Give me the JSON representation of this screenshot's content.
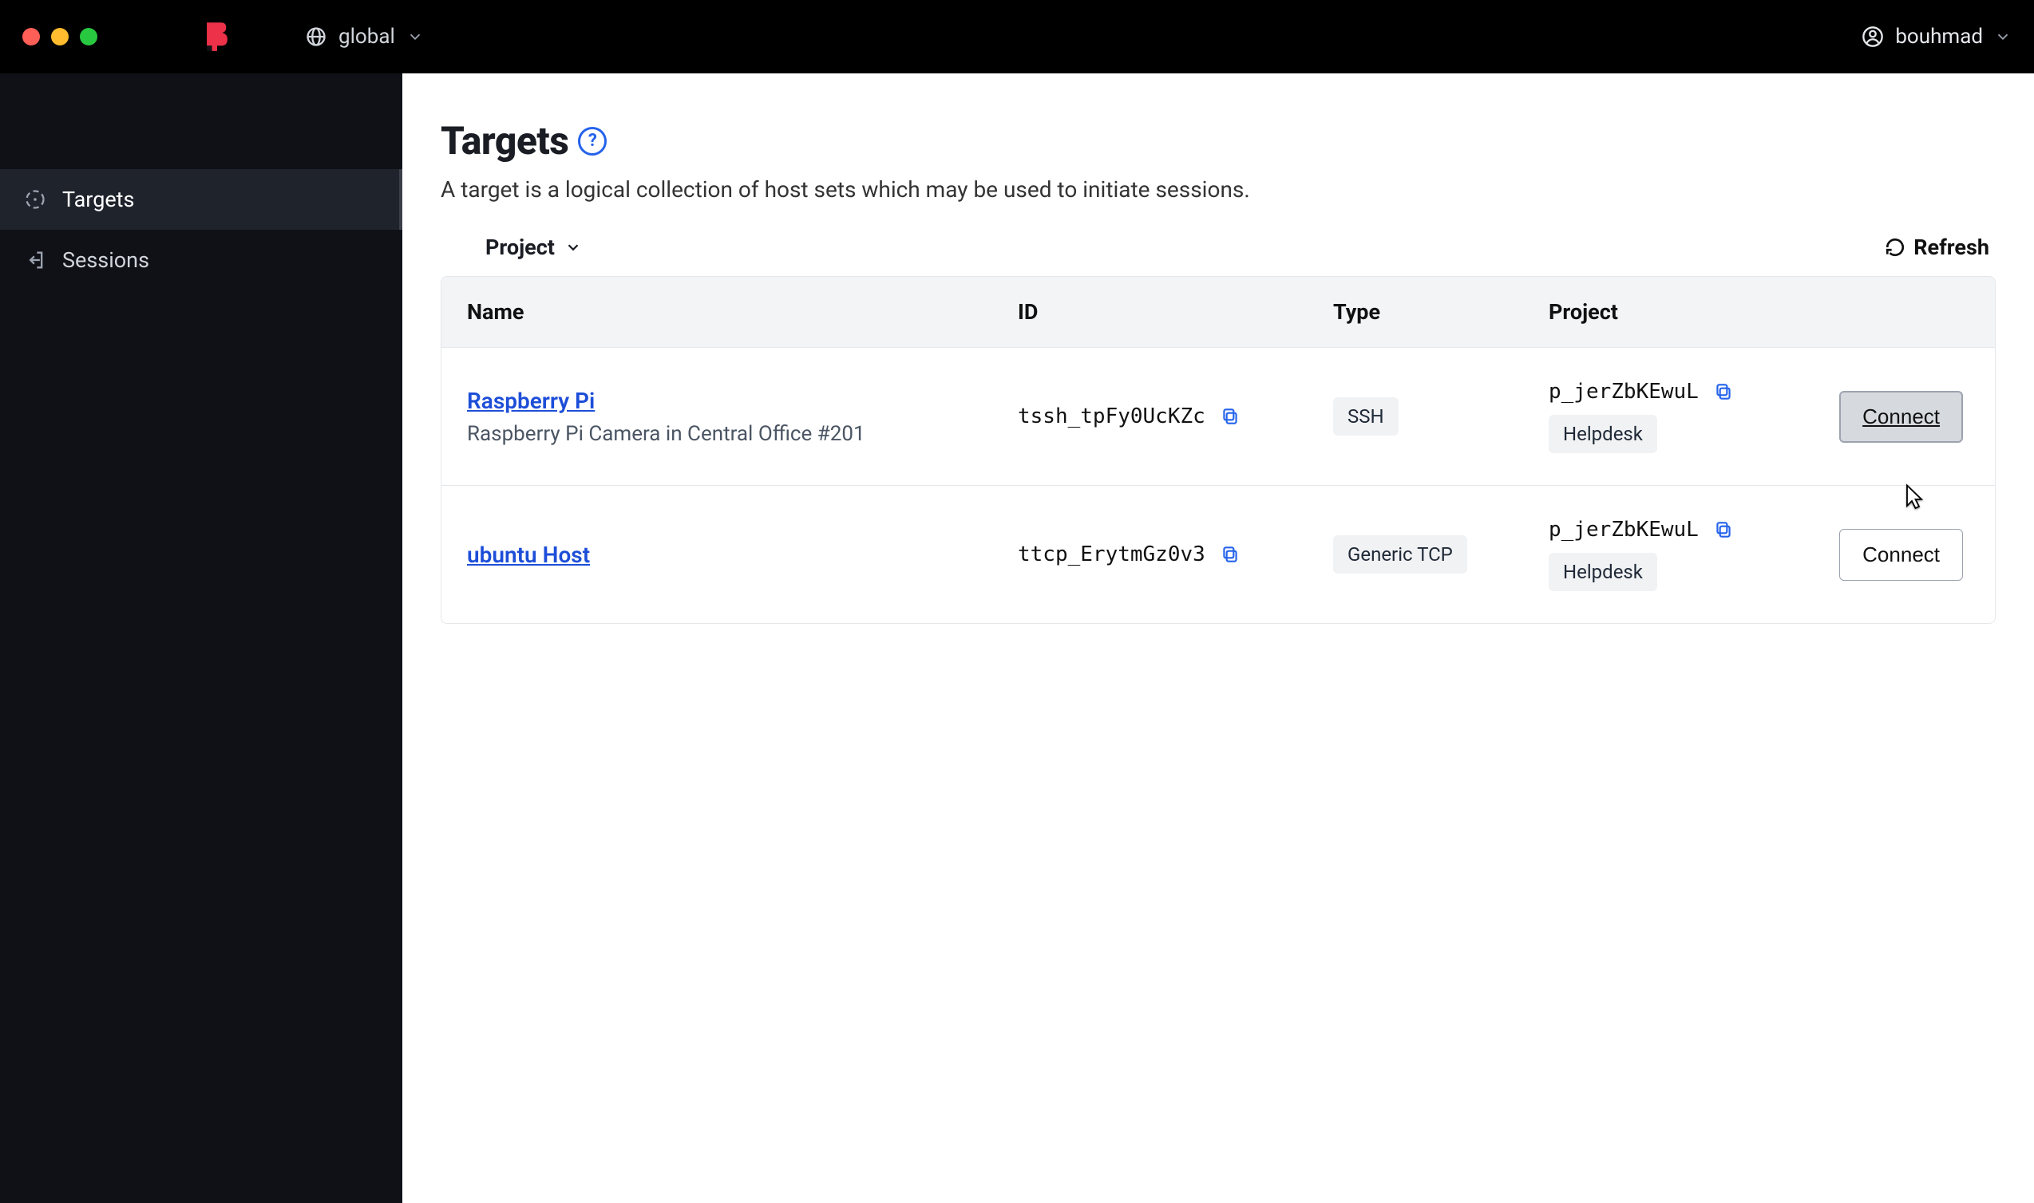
{
  "header": {
    "scope_label": "global",
    "username": "bouhmad"
  },
  "sidebar": {
    "items": [
      {
        "label": "Targets",
        "icon": "target-icon",
        "active": true
      },
      {
        "label": "Sessions",
        "icon": "exit-icon",
        "active": false
      }
    ]
  },
  "main": {
    "title": "Targets",
    "description": "A target is a logical collection of host sets which may be used to initiate sessions.",
    "project_filter_label": "Project",
    "refresh_label": "Refresh"
  },
  "table": {
    "columns": [
      "Name",
      "ID",
      "Type",
      "Project",
      ""
    ],
    "rows": [
      {
        "name": "Raspberry Pi",
        "description": "Raspberry Pi Camera in Central Office #201",
        "id": "tssh_tpFy0UcKZc",
        "type": "SSH",
        "project_id": "p_jerZbKEwuL",
        "project_name": "Helpdesk",
        "action_label": "Connect",
        "action_hover": true
      },
      {
        "name": "ubuntu Host",
        "description": "",
        "id": "ttcp_ErytmGz0v3",
        "type": "Generic TCP",
        "project_id": "p_jerZbKEwuL",
        "project_name": "Helpdesk",
        "action_label": "Connect",
        "action_hover": false
      }
    ]
  }
}
